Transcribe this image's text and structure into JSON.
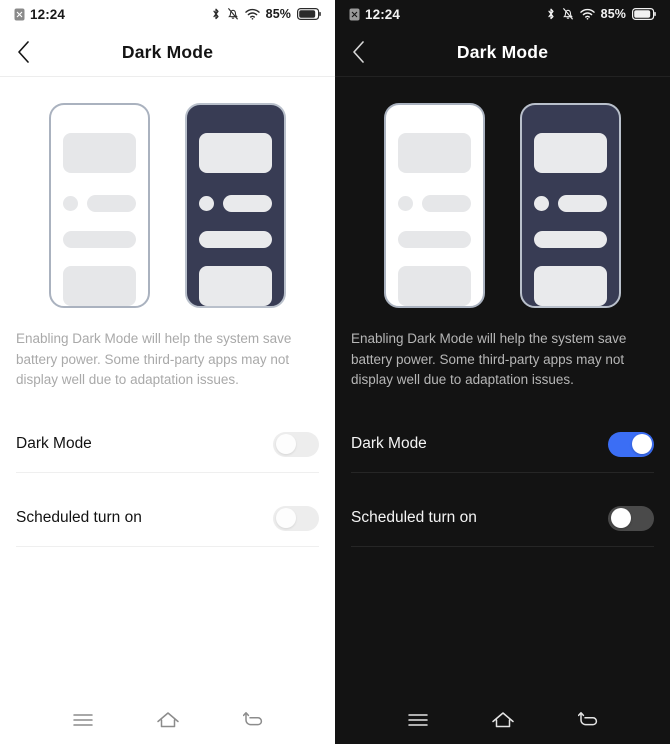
{
  "panels": [
    {
      "theme": "light",
      "status": {
        "time": "12:24",
        "sim_icon": "sim-card-icon",
        "bluetooth_icon": "bluetooth-icon",
        "silent_icon": "bell-muted-icon",
        "wifi_icon": "wifi-icon",
        "battery_percent": "85%",
        "battery_icon": "battery-icon"
      },
      "header": {
        "back_icon": "back-chevron-icon",
        "title": "Dark Mode"
      },
      "illustration": {
        "light_phone_name": "light-mode-preview-phone",
        "dark_phone_name": "dark-mode-preview-phone"
      },
      "description": "Enabling Dark Mode will help the system save battery power. Some third-party apps may not display well due to adaptation issues.",
      "rows": [
        {
          "label": "Dark Mode",
          "state": "off"
        },
        {
          "label": "Scheduled turn on",
          "state": "off"
        }
      ],
      "nav": {
        "recents_icon": "menu-recents-icon",
        "home_icon": "home-icon",
        "back_icon": "back-arrow-icon"
      }
    },
    {
      "theme": "dark",
      "status": {
        "time": "12:24",
        "sim_icon": "sim-card-icon",
        "bluetooth_icon": "bluetooth-icon",
        "silent_icon": "bell-muted-icon",
        "wifi_icon": "wifi-icon",
        "battery_percent": "85%",
        "battery_icon": "battery-icon"
      },
      "header": {
        "back_icon": "back-chevron-icon",
        "title": "Dark Mode"
      },
      "illustration": {
        "light_phone_name": "light-mode-preview-phone",
        "dark_phone_name": "dark-mode-preview-phone"
      },
      "description": "Enabling Dark Mode will help the system save battery power. Some third-party apps may not display well due to adaptation issues.",
      "rows": [
        {
          "label": "Dark Mode",
          "state": "on"
        },
        {
          "label": "Scheduled turn on",
          "state": "off"
        }
      ],
      "nav": {
        "recents_icon": "menu-recents-icon",
        "home_icon": "home-icon",
        "back_icon": "back-arrow-icon"
      }
    }
  ],
  "colors": {
    "accent_on": "#3b6ef5",
    "light_bg": "#ffffff",
    "dark_bg": "#131313",
    "phone_navy": "#383c54",
    "phone_border_light": "#aab2bf",
    "phone_border_dark": "#b9c0cb",
    "placeholder_bar": "#e6e7e9"
  }
}
